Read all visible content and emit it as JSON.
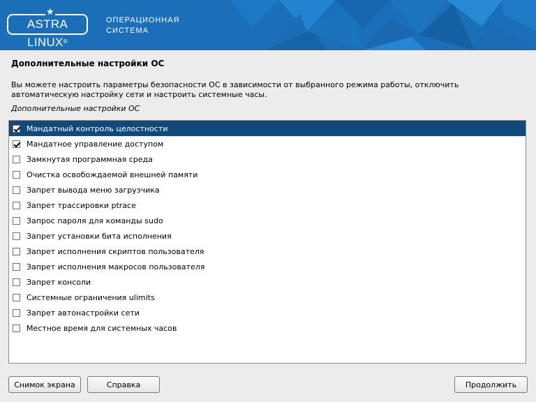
{
  "header": {
    "logo_text": "ASTRA LINUX",
    "logo_registered": "®",
    "subtitle_line1": "ОПЕРАЦИОННАЯ",
    "subtitle_line2": "СИСТЕМА",
    "banner_color": "#1a6fb8"
  },
  "page": {
    "title": "Дополнительные настройки ОС",
    "description_line1": "Вы можете настроить параметры безопасности ОС в зависимости от выбранного режима работы, отключить",
    "description_line2": "автоматическую настройку сети и настроить системные часы.",
    "list_caption": "Дополнительные настройки ОС"
  },
  "options": [
    {
      "label": "Мандатный контроль целостности",
      "checked": true,
      "selected": true
    },
    {
      "label": "Мандатное управление доступом",
      "checked": true,
      "selected": false
    },
    {
      "label": "Замкнутая программная среда",
      "checked": false,
      "selected": false
    },
    {
      "label": "Очистка освобождаемой внешней памяти",
      "checked": false,
      "selected": false
    },
    {
      "label": "Запрет вывода меню загрузчика",
      "checked": false,
      "selected": false
    },
    {
      "label": "Запрет трассировки ptrace",
      "checked": false,
      "selected": false
    },
    {
      "label": "Запрос пароля для команды sudo",
      "checked": false,
      "selected": false
    },
    {
      "label": "Запрет установки бита исполнения",
      "checked": false,
      "selected": false
    },
    {
      "label": "Запрет исполнения скриптов пользователя",
      "checked": false,
      "selected": false
    },
    {
      "label": "Запрет исполнения макросов пользователя",
      "checked": false,
      "selected": false
    },
    {
      "label": "Запрет консоли",
      "checked": false,
      "selected": false
    },
    {
      "label": "Системные ограничения ulimits",
      "checked": false,
      "selected": false
    },
    {
      "label": "Запрет автонастройки сети",
      "checked": false,
      "selected": false
    },
    {
      "label": "Местное время для системных часов",
      "checked": false,
      "selected": false
    }
  ],
  "buttons": {
    "screenshot": "Снимок экрана",
    "help": "Справка",
    "continue": "Продолжить"
  },
  "colors": {
    "selection": "#12497d",
    "background": "#ececec"
  }
}
